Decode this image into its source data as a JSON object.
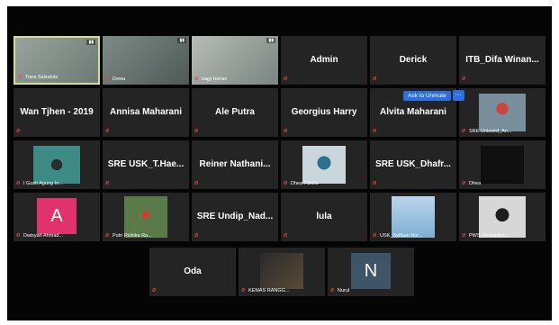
{
  "meeting": {
    "ask_to_unmute": "Ask to Unmute",
    "more_label": "···",
    "accent_color": "#2d6fe0",
    "mic_muted_color": "#e04b4b"
  },
  "participants": [
    {
      "label": "Tiara Salsabila",
      "name": "",
      "kind": "video",
      "active": true
    },
    {
      "label": "Dewa",
      "name": "",
      "kind": "video"
    },
    {
      "label": "zagy benan",
      "name": "",
      "kind": "video"
    },
    {
      "label": "",
      "name": "Admin",
      "kind": "name"
    },
    {
      "label": "",
      "name": "Derick",
      "kind": "name"
    },
    {
      "label": "",
      "name": "ITB_Difa  Winan...",
      "kind": "name"
    },
    {
      "label": "",
      "name": "Wan Tjhen - 2019",
      "kind": "name"
    },
    {
      "label": "",
      "name": "Annisa Maharani",
      "kind": "name"
    },
    {
      "label": "",
      "name": "Ale Putra",
      "kind": "name"
    },
    {
      "label": "",
      "name": "Georgius Harry",
      "kind": "name"
    },
    {
      "label": "",
      "name": "Alvita Maharani",
      "kind": "name"
    },
    {
      "label": "SRE Unisoed_An...",
      "name": "",
      "kind": "photo"
    },
    {
      "label": "I Gusti Agung In...",
      "name": "",
      "kind": "photo"
    },
    {
      "label": "",
      "name": "SRE  USK_T.Hae...",
      "kind": "name"
    },
    {
      "label": "",
      "name": "Reiner  Nathani...",
      "kind": "name"
    },
    {
      "label": "Dhea Fahira",
      "name": "",
      "kind": "photo"
    },
    {
      "label": "",
      "name": "SRE  USK_Dhafr...",
      "kind": "name"
    },
    {
      "label": "Dhea",
      "name": "",
      "kind": "photo"
    },
    {
      "label": "Dwisyah Ahmad...",
      "name": "",
      "kind": "avatar",
      "initial": "A",
      "avatar_color": "#e0336e"
    },
    {
      "label": "Putri Rizkika Ra...",
      "name": "",
      "kind": "photo"
    },
    {
      "label": "",
      "name": "SRE  Undip_Nad...",
      "kind": "name"
    },
    {
      "label": "",
      "name": "lula",
      "kind": "name"
    },
    {
      "label": "USK_Syifaan Nur...",
      "name": "",
      "kind": "photo"
    },
    {
      "label": "PWS_Romadlon...",
      "name": "",
      "kind": "photo"
    },
    {
      "label": "",
      "name": "Oda",
      "kind": "name"
    },
    {
      "label": "KEMAS RANGG...",
      "name": "",
      "kind": "photo"
    },
    {
      "label": "Nurul",
      "name": "",
      "kind": "avatar",
      "initial": "N",
      "avatar_color": "#3d5566"
    }
  ]
}
